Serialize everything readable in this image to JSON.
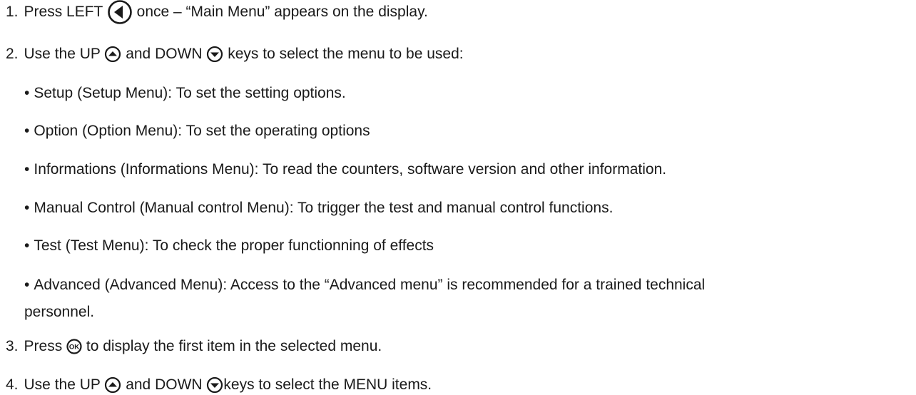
{
  "steps": [
    {
      "number": "1.",
      "text_before": "Press LEFT ",
      "key_icon": "left-arrow-circle-icon",
      "text_after": " once – “Main Menu” appears on the display."
    },
    {
      "number": "2.",
      "text_before": "Use the UP ",
      "key_icon_1": "up-arrow-circle-icon",
      "text_middle": " and DOWN ",
      "key_icon_2": "down-arrow-circle-icon",
      "text_after": " keys to select the menu to be used:"
    },
    {
      "number": "3.",
      "text_before": "Press ",
      "key_icon": "ok-circle-icon",
      "key_label": "OK",
      "text_after": " to display the first item in the selected menu."
    },
    {
      "number": "4.",
      "text_before": "Use the UP ",
      "key_icon_1": "up-arrow-circle-icon",
      "text_middle": " and DOWN ",
      "key_icon_2": "down-arrow-circle-icon",
      "text_after": "keys to select the MENU items."
    }
  ],
  "bullets": [
    {
      "symbol": "•",
      "text": "Setup (Setup Menu): To set the setting options."
    },
    {
      "symbol": "•",
      "text": "Option (Option Menu): To set the operating options"
    },
    {
      "symbol": "•",
      "text": "Informations (Informations Menu): To read the counters, software version and other information."
    },
    {
      "symbol": "•",
      "text": "Manual Control (Manual control Menu): To trigger the test and manual control functions."
    },
    {
      "symbol": "•",
      "text": "Test (Test Menu): To check the proper functionning of effects"
    },
    {
      "symbol": "•",
      "text": "Advanced (Advanced Menu): Access to the “Advanced menu” is recommended for a trained technical",
      "continuation": "personnel."
    }
  ],
  "colors": {
    "text": "#1a1a1a",
    "icon_stroke": "#1a1a1a",
    "background": "#ffffff"
  }
}
